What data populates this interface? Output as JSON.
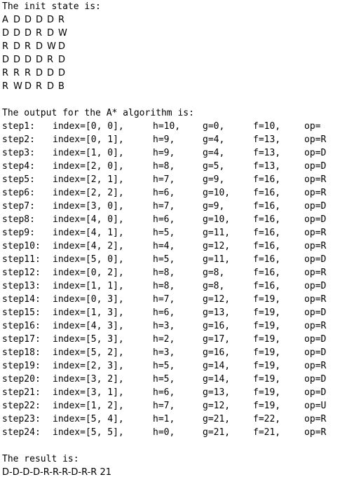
{
  "init_heading": "The init state is:",
  "grid": [
    [
      "A",
      "D",
      "D",
      "D",
      "D",
      "R"
    ],
    [
      "D",
      "D",
      "D",
      "R",
      "D",
      "W"
    ],
    [
      "R",
      "D",
      "R",
      "D",
      "W",
      "D"
    ],
    [
      "D",
      "D",
      "D",
      "D",
      "R",
      "D"
    ],
    [
      "R",
      "R",
      "R",
      "D",
      "D",
      "D"
    ],
    [
      "R",
      "W",
      "D",
      "R",
      "D",
      "B"
    ]
  ],
  "output_heading": "The output for the A* algorithm is:",
  "steps": [
    {
      "step": "step1:",
      "index": "index=[0, 0],",
      "h": "h=10,",
      "g": "g=0,",
      "f": "f=10,",
      "op": "op="
    },
    {
      "step": "step2:",
      "index": "index=[0, 1],",
      "h": "h=9,",
      "g": "g=4,",
      "f": "f=13,",
      "op": "op=R"
    },
    {
      "step": "step3:",
      "index": "index=[1, 0],",
      "h": "h=9,",
      "g": "g=4,",
      "f": "f=13,",
      "op": "op=D"
    },
    {
      "step": "step4:",
      "index": "index=[2, 0],",
      "h": "h=8,",
      "g": "g=5,",
      "f": "f=13,",
      "op": "op=D"
    },
    {
      "step": "step5:",
      "index": "index=[2, 1],",
      "h": "h=7,",
      "g": "g=9,",
      "f": "f=16,",
      "op": "op=R"
    },
    {
      "step": "step6:",
      "index": "index=[2, 2],",
      "h": "h=6,",
      "g": "g=10,",
      "f": "f=16,",
      "op": "op=R"
    },
    {
      "step": "step7:",
      "index": "index=[3, 0],",
      "h": "h=7,",
      "g": "g=9,",
      "f": "f=16,",
      "op": "op=D"
    },
    {
      "step": "step8:",
      "index": "index=[4, 0],",
      "h": "h=6,",
      "g": "g=10,",
      "f": "f=16,",
      "op": "op=D"
    },
    {
      "step": "step9:",
      "index": "index=[4, 1],",
      "h": "h=5,",
      "g": "g=11,",
      "f": "f=16,",
      "op": "op=R"
    },
    {
      "step": "step10:",
      "index": "index=[4, 2],",
      "h": "h=4,",
      "g": "g=12,",
      "f": "f=16,",
      "op": "op=R"
    },
    {
      "step": "step11:",
      "index": "index=[5, 0],",
      "h": "h=5,",
      "g": "g=11,",
      "f": "f=16,",
      "op": "op=D"
    },
    {
      "step": "step12:",
      "index": "index=[0, 2],",
      "h": "h=8,",
      "g": "g=8,",
      "f": "f=16,",
      "op": "op=R"
    },
    {
      "step": "step13:",
      "index": "index=[1, 1],",
      "h": "h=8,",
      "g": "g=8,",
      "f": "f=16,",
      "op": "op=D"
    },
    {
      "step": "step14:",
      "index": "index=[0, 3],",
      "h": "h=7,",
      "g": "g=12,",
      "f": "f=19,",
      "op": "op=R"
    },
    {
      "step": "step15:",
      "index": "index=[1, 3],",
      "h": "h=6,",
      "g": "g=13,",
      "f": "f=19,",
      "op": "op=D"
    },
    {
      "step": "step16:",
      "index": "index=[4, 3],",
      "h": "h=3,",
      "g": "g=16,",
      "f": "f=19,",
      "op": "op=R"
    },
    {
      "step": "step17:",
      "index": "index=[5, 3],",
      "h": "h=2,",
      "g": "g=17,",
      "f": "f=19,",
      "op": "op=D"
    },
    {
      "step": "step18:",
      "index": "index=[5, 2],",
      "h": "h=3,",
      "g": "g=16,",
      "f": "f=19,",
      "op": "op=D"
    },
    {
      "step": "step19:",
      "index": "index=[2, 3],",
      "h": "h=5,",
      "g": "g=14,",
      "f": "f=19,",
      "op": "op=R"
    },
    {
      "step": "step20:",
      "index": "index=[3, 2],",
      "h": "h=5,",
      "g": "g=14,",
      "f": "f=19,",
      "op": "op=D"
    },
    {
      "step": "step21:",
      "index": "index=[3, 1],",
      "h": "h=6,",
      "g": "g=13,",
      "f": "f=19,",
      "op": "op=D"
    },
    {
      "step": "step22:",
      "index": "index=[1, 2],",
      "h": "h=7,",
      "g": "g=12,",
      "f": "f=19,",
      "op": "op=U"
    },
    {
      "step": "step23:",
      "index": "index=[5, 4],",
      "h": "h=1,",
      "g": "g=21,",
      "f": "f=22,",
      "op": "op=R"
    },
    {
      "step": "step24:",
      "index": "index=[5, 5],",
      "h": "h=0,",
      "g": "g=21,",
      "f": "f=21,",
      "op": "op=R"
    }
  ],
  "result_heading": "The result is:",
  "result_value": "D-D-D-D-R-R-R-D-R-R 21"
}
